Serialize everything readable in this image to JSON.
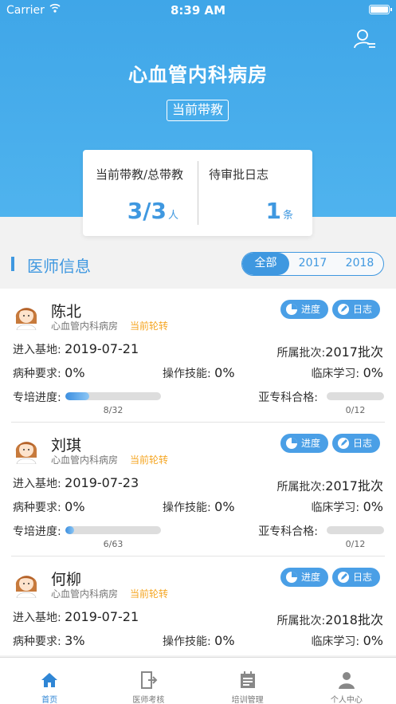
{
  "status_bar": {
    "carrier": "Carrier",
    "time": "8:39 AM"
  },
  "header": {
    "title": "心血管内科病房",
    "badge": "当前带教"
  },
  "stats": {
    "left_label": "当前带教/总带教",
    "left_value": "3/3",
    "left_unit": "人",
    "right_label": "待审批日志",
    "right_value": "1",
    "right_unit": "条"
  },
  "section": {
    "title": "医师信息",
    "filters": [
      "全部",
      "2017",
      "2018"
    ],
    "active_filter": "全部"
  },
  "labels": {
    "enter_base": "进入基地:",
    "batch": "所属批次:",
    "disease_req": "病种要求:",
    "skill": "操作技能:",
    "clinical": "临床学习:",
    "special_progress": "专培进度:",
    "sub_qualified": "亚专科合格:",
    "progress_btn": "进度",
    "log_btn": "日志"
  },
  "doctors": [
    {
      "name": "陈北",
      "dept": "心血管内科病房",
      "state": "当前轮转",
      "enter_date": "2019-07-21",
      "batch": "2017批次",
      "disease": "0%",
      "skill": "0%",
      "clinical": "0%",
      "progress_text": "8/32",
      "progress_ratio": 0.25,
      "sub_text": "0/12",
      "sub_ratio": 0
    },
    {
      "name": "刘琪",
      "dept": "心血管内科病房",
      "state": "当前轮转",
      "enter_date": "2019-07-23",
      "batch": "2017批次",
      "disease": "0%",
      "skill": "0%",
      "clinical": "0%",
      "progress_text": "6/63",
      "progress_ratio": 0.095,
      "sub_text": "0/12",
      "sub_ratio": 0
    },
    {
      "name": "何柳",
      "dept": "心血管内科病房",
      "state": "当前轮转",
      "enter_date": "2019-07-21",
      "batch": "2018批次",
      "disease": "3%",
      "skill": "0%",
      "clinical": "0%"
    }
  ],
  "tabbar": [
    {
      "label": "首页",
      "icon": "home-icon",
      "active": true
    },
    {
      "label": "医师考核",
      "icon": "exit-door-icon",
      "active": false
    },
    {
      "label": "培训管理",
      "icon": "calendar-icon",
      "active": false
    },
    {
      "label": "个人中心",
      "icon": "person-icon",
      "active": false
    }
  ],
  "colors": {
    "primary": "#3f98e0",
    "accent_orange": "#f5a623",
    "header_bg": "#4fb3ee"
  }
}
